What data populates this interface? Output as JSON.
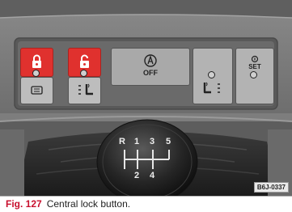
{
  "figure": {
    "number": "Fig. 127",
    "caption": "Central lock button.",
    "reference_code": "B6J-0337"
  },
  "panel": {
    "off_button_label": "OFF",
    "set_button_label": "SET",
    "gear_knob_labels": [
      "R",
      "1",
      "3",
      "5",
      "2",
      "4"
    ]
  },
  "colors": {
    "lock_button_red": "#e0312e",
    "caption_number_red": "#c8102e"
  },
  "icons": [
    "lock-closed-icon",
    "lock-open-icon",
    "auto-start-stop-icon",
    "parking-distance-icon",
    "rear-window-heating-icon",
    "seat-heating-left-icon",
    "seat-heating-right-icon"
  ]
}
